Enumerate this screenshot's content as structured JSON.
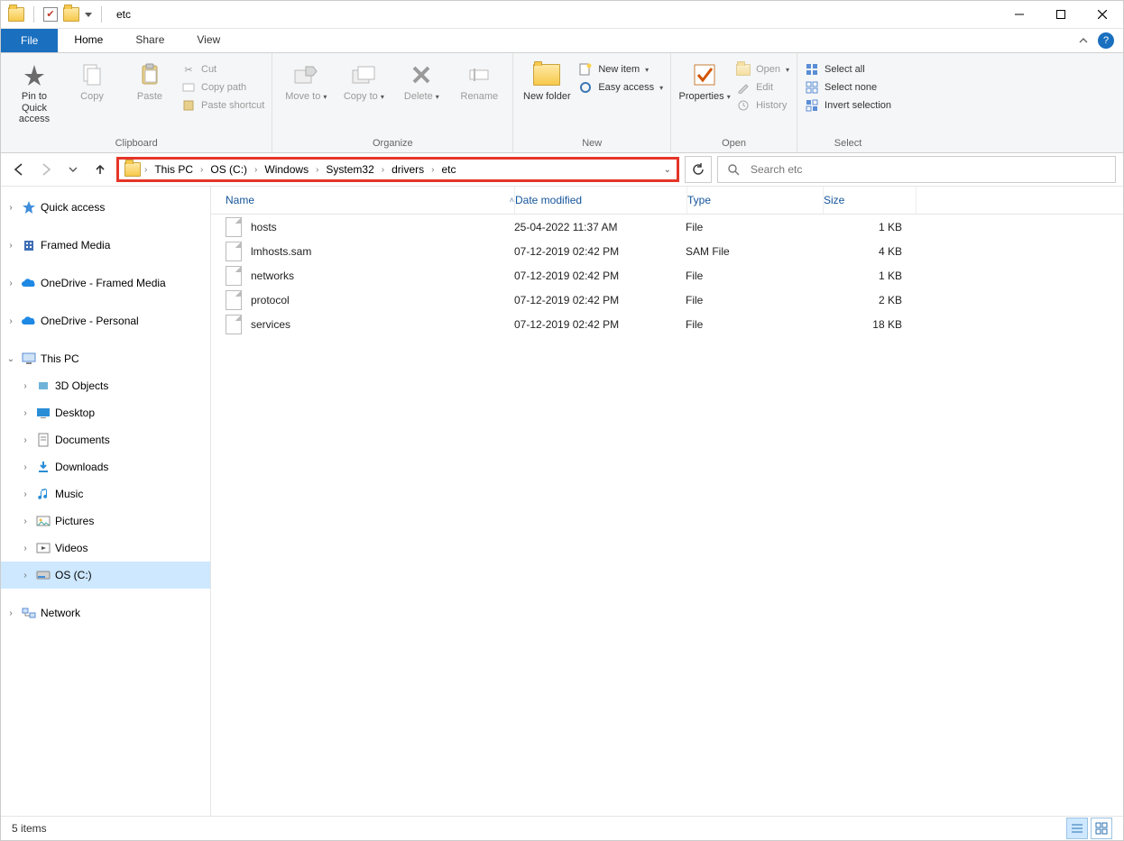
{
  "window": {
    "title": "etc"
  },
  "tabs": {
    "file": "File",
    "home": "Home",
    "share": "Share",
    "view": "View"
  },
  "ribbon": {
    "pin": "Pin to Quick access",
    "copy": "Copy",
    "paste": "Paste",
    "cut": "Cut",
    "copy_path": "Copy path",
    "paste_shortcut": "Paste shortcut",
    "move_to": "Move to",
    "copy_to": "Copy to",
    "delete": "Delete",
    "rename": "Rename",
    "new_folder": "New folder",
    "new_item": "New item",
    "easy_access": "Easy access",
    "properties": "Properties",
    "open": "Open",
    "edit": "Edit",
    "history": "History",
    "select_all": "Select all",
    "select_none": "Select none",
    "invert_selection": "Invert selection",
    "groups": {
      "clipboard": "Clipboard",
      "organize": "Organize",
      "new": "New",
      "open": "Open",
      "select": "Select"
    }
  },
  "breadcrumb": [
    "This PC",
    "OS (C:)",
    "Windows",
    "System32",
    "drivers",
    "etc"
  ],
  "search": {
    "placeholder": "Search etc"
  },
  "tree": {
    "quick_access": "Quick access",
    "framed_media": "Framed Media",
    "onedrive_fm": "OneDrive - Framed Media",
    "onedrive_personal": "OneDrive - Personal",
    "this_pc": "This PC",
    "children": [
      "3D Objects",
      "Desktop",
      "Documents",
      "Downloads",
      "Music",
      "Pictures",
      "Videos",
      "OS (C:)"
    ],
    "network": "Network"
  },
  "columns": {
    "name": "Name",
    "date": "Date modified",
    "type": "Type",
    "size": "Size"
  },
  "files": [
    {
      "name": "hosts",
      "date": "25-04-2022 11:37 AM",
      "type": "File",
      "size": "1 KB"
    },
    {
      "name": "lmhosts.sam",
      "date": "07-12-2019 02:42 PM",
      "type": "SAM File",
      "size": "4 KB"
    },
    {
      "name": "networks",
      "date": "07-12-2019 02:42 PM",
      "type": "File",
      "size": "1 KB"
    },
    {
      "name": "protocol",
      "date": "07-12-2019 02:42 PM",
      "type": "File",
      "size": "2 KB"
    },
    {
      "name": "services",
      "date": "07-12-2019 02:42 PM",
      "type": "File",
      "size": "18 KB"
    }
  ],
  "status": {
    "count": "5 items"
  }
}
